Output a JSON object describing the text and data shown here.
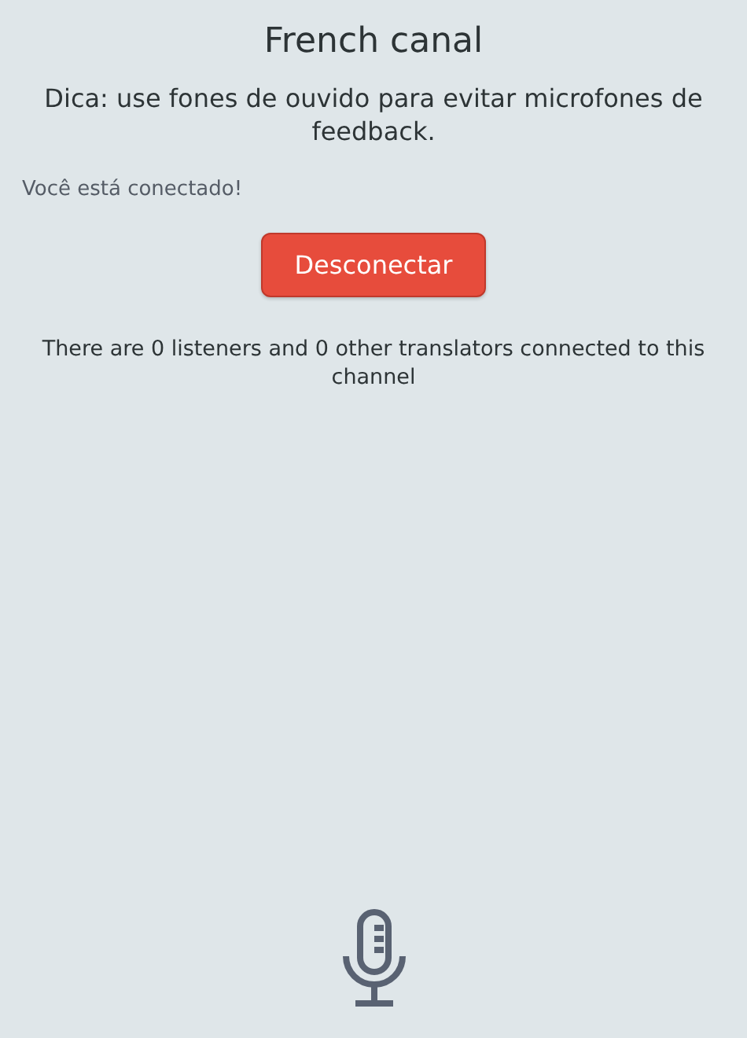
{
  "title": "French canal",
  "tip": "Dica: use fones de ouvido para evitar microfones de feedback.",
  "status": "Você está conectado!",
  "disconnect_button": "Desconectar",
  "info": "There are 0 listeners and 0 other translators connected to this channel"
}
